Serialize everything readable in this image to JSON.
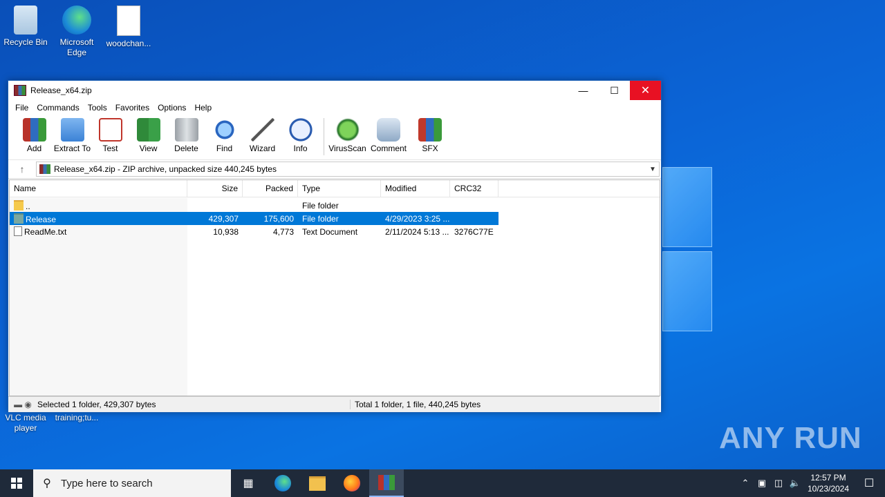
{
  "desktop": {
    "icons": [
      {
        "label": "Recycle Bin"
      },
      {
        "label": "Microsoft Edge"
      },
      {
        "label": "woodchan..."
      },
      {
        "label": "VLC media player"
      },
      {
        "label": "training;tu..."
      }
    ],
    "watermark": "ANY RUN"
  },
  "window": {
    "title": "Release_x64.zip",
    "menu": [
      "File",
      "Commands",
      "Tools",
      "Favorites",
      "Options",
      "Help"
    ],
    "toolbar": [
      "Add",
      "Extract To",
      "Test",
      "View",
      "Delete",
      "Find",
      "Wizard",
      "Info",
      "VirusScan",
      "Comment",
      "SFX"
    ],
    "address": "Release_x64.zip - ZIP archive, unpacked size 440,245 bytes",
    "columns": [
      "Name",
      "Size",
      "Packed",
      "Type",
      "Modified",
      "CRC32"
    ],
    "files": [
      {
        "name": "..",
        "size": "",
        "packed": "",
        "type": "File folder",
        "modified": "",
        "crc": ""
      },
      {
        "name": "Release",
        "size": "429,307",
        "packed": "175,600",
        "type": "File folder",
        "modified": "4/29/2023 3:25 ...",
        "crc": ""
      },
      {
        "name": "ReadMe.txt",
        "size": "10,938",
        "packed": "4,773",
        "type": "Text Document",
        "modified": "2/11/2024 5:13 ...",
        "crc": "3276C77E"
      }
    ],
    "status_left": "Selected 1 folder, 429,307 bytes",
    "status_right": "Total 1 folder, 1 file, 440,245 bytes"
  },
  "taskbar": {
    "search_placeholder": "Type here to search",
    "time": "12:57 PM",
    "date": "10/23/2024"
  }
}
